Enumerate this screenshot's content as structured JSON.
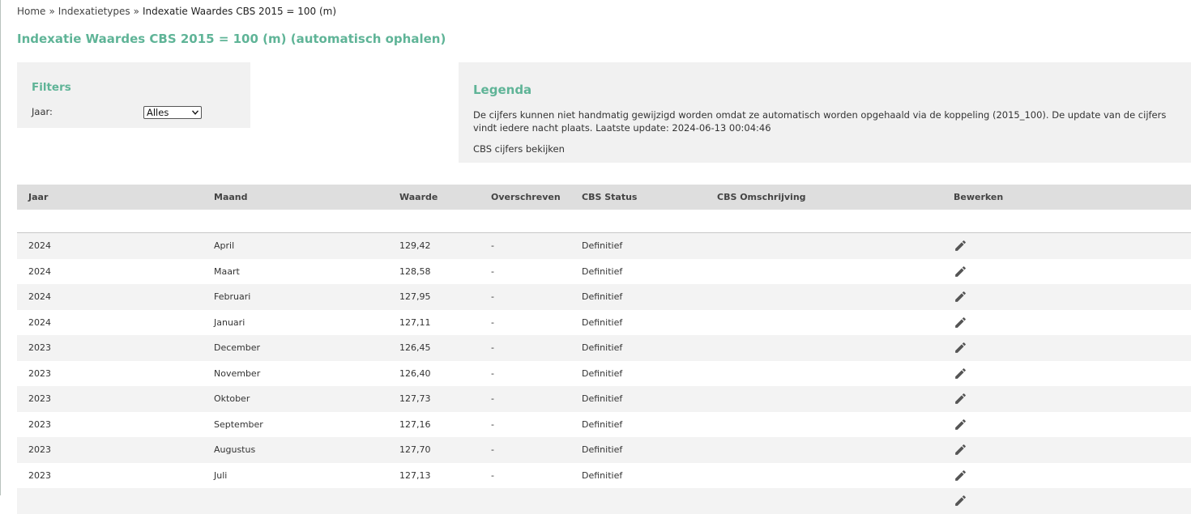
{
  "breadcrumb": {
    "items": [
      "Home",
      "Indexatietypes"
    ],
    "separator": "»",
    "current": "Indexatie Waardes CBS 2015 = 100 (m)"
  },
  "page_title": "Indexatie Waardes CBS 2015 = 100 (m) (automatisch ophalen)",
  "filters": {
    "title": "Filters",
    "year_label": "Jaar:",
    "year_selected": "Alles"
  },
  "legend": {
    "title": "Legenda",
    "text": "De cijfers kunnen niet handmatig gewijzigd worden omdat ze automatisch worden opgehaald via de koppeling (2015_100). De update van de cijfers vindt iedere nacht plaats. Laatste update: 2024-06-13 00:04:46",
    "link": "CBS cijfers bekijken"
  },
  "table": {
    "headers": [
      "Jaar",
      "Maand",
      "Waarde",
      "Overschreven",
      "CBS Status",
      "CBS Omschrijving",
      "Bewerken"
    ],
    "rows": [
      {
        "jaar": "2024",
        "maand": "April",
        "waarde": "129,42",
        "overschreven": "-",
        "status": "Definitief",
        "omschrijving": ""
      },
      {
        "jaar": "2024",
        "maand": "Maart",
        "waarde": "128,58",
        "overschreven": "-",
        "status": "Definitief",
        "omschrijving": ""
      },
      {
        "jaar": "2024",
        "maand": "Februari",
        "waarde": "127,95",
        "overschreven": "-",
        "status": "Definitief",
        "omschrijving": ""
      },
      {
        "jaar": "2024",
        "maand": "Januari",
        "waarde": "127,11",
        "overschreven": "-",
        "status": "Definitief",
        "omschrijving": ""
      },
      {
        "jaar": "2023",
        "maand": "December",
        "waarde": "126,45",
        "overschreven": "-",
        "status": "Definitief",
        "omschrijving": ""
      },
      {
        "jaar": "2023",
        "maand": "November",
        "waarde": "126,40",
        "overschreven": "-",
        "status": "Definitief",
        "omschrijving": ""
      },
      {
        "jaar": "2023",
        "maand": "Oktober",
        "waarde": "127,73",
        "overschreven": "-",
        "status": "Definitief",
        "omschrijving": ""
      },
      {
        "jaar": "2023",
        "maand": "September",
        "waarde": "127,16",
        "overschreven": "-",
        "status": "Definitief",
        "omschrijving": ""
      },
      {
        "jaar": "2023",
        "maand": "Augustus",
        "waarde": "127,70",
        "overschreven": "-",
        "status": "Definitief",
        "omschrijving": ""
      },
      {
        "jaar": "2023",
        "maand": "Juli",
        "waarde": "127,13",
        "overschreven": "-",
        "status": "Definitief",
        "omschrijving": ""
      },
      {
        "jaar": "",
        "maand": "",
        "waarde": "",
        "overschreven": "",
        "status": "",
        "omschrijving": ""
      }
    ],
    "edit_icon": "pencil-icon"
  },
  "colors": {
    "accent": "#5fb497",
    "header_bg": "#dedede",
    "panel_bg": "#f1f1f1",
    "row_alt_bg": "#f3f3f3"
  }
}
